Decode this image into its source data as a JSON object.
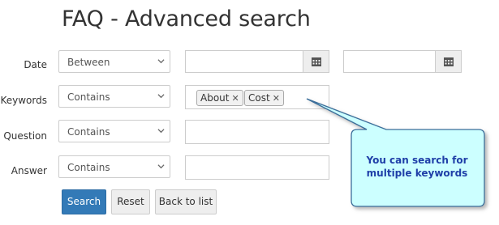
{
  "page": {
    "title": "FAQ - Advanced search"
  },
  "filters": {
    "date": {
      "label": "Date",
      "operator": "Between",
      "from_value": "",
      "to_value": ""
    },
    "keywords": {
      "label": "Keywords",
      "operator": "Contains",
      "tags": [
        "About",
        "Cost"
      ]
    },
    "question": {
      "label": "Question",
      "operator": "Contains",
      "value": ""
    },
    "answer": {
      "label": "Answer",
      "operator": "Contains",
      "value": ""
    }
  },
  "buttons": {
    "search": "Search",
    "reset": "Reset",
    "back": "Back to list"
  },
  "callout": {
    "text": "You can search for multiple keywords"
  },
  "colors": {
    "primary": "#337ab7",
    "callout_fill": "#ccffff",
    "callout_text": "#1f3fa8"
  },
  "icons": {
    "calendar": "calendar-icon",
    "chevron": "chevron-down-icon",
    "remove": "tag-remove-icon"
  }
}
